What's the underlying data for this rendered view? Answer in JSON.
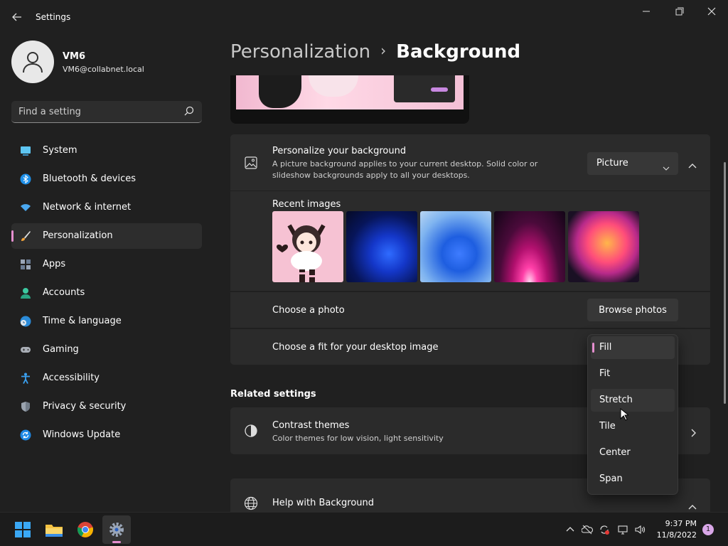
{
  "window": {
    "title": "Settings"
  },
  "user": {
    "name": "VM6",
    "email": "VM6@collabnet.local"
  },
  "search": {
    "placeholder": "Find a setting"
  },
  "sidebar": {
    "items": [
      {
        "label": "System",
        "icon": "monitor-icon"
      },
      {
        "label": "Bluetooth & devices",
        "icon": "bluetooth-icon"
      },
      {
        "label": "Network & internet",
        "icon": "wifi-icon"
      },
      {
        "label": "Personalization",
        "icon": "brush-icon",
        "active": true
      },
      {
        "label": "Apps",
        "icon": "apps-icon"
      },
      {
        "label": "Accounts",
        "icon": "person-icon"
      },
      {
        "label": "Time & language",
        "icon": "clock-globe-icon"
      },
      {
        "label": "Gaming",
        "icon": "gamepad-icon"
      },
      {
        "label": "Accessibility",
        "icon": "accessibility-icon"
      },
      {
        "label": "Privacy & security",
        "icon": "shield-icon"
      },
      {
        "label": "Windows Update",
        "icon": "update-icon"
      }
    ]
  },
  "breadcrumb": {
    "parent": "Personalization",
    "separator": "›",
    "current": "Background"
  },
  "background_card": {
    "title": "Personalize your background",
    "description": "A picture background applies to your current desktop. Solid color or slideshow backgrounds apply to all your desktops.",
    "selected_type": "Picture"
  },
  "recent_images": {
    "label": "Recent images"
  },
  "choose_photo": {
    "label": "Choose a photo",
    "button": "Browse photos"
  },
  "fit": {
    "label": "Choose a fit for your desktop image",
    "options": [
      "Fill",
      "Fit",
      "Stretch",
      "Tile",
      "Center",
      "Span"
    ],
    "selected": "Fill",
    "hovered": "Stretch"
  },
  "related": {
    "title": "Related settings",
    "contrast_title": "Contrast themes",
    "contrast_desc": "Color themes for low vision, light sensitivity"
  },
  "help": {
    "title": "Help with Background"
  },
  "taskbar": {
    "time": "9:37 PM",
    "date": "11/8/2022",
    "notifications": "1"
  },
  "colors": {
    "accent": "#e58ecf",
    "background": "#202020",
    "card": "#2b2b2b"
  }
}
